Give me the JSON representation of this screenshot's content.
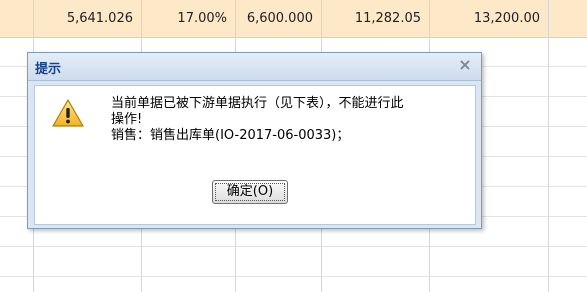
{
  "sheet": {
    "row": [
      "5,641.026",
      "17.00%",
      "6,600.000",
      "11,282.05",
      "13,200.00"
    ]
  },
  "dialog": {
    "title": "提示",
    "close_glyph": "×",
    "icon": "warning-icon",
    "message_line1": "当前单据已被下游单据执行（见下表），不能进行此",
    "message_line2": "操作!",
    "message_line3": "销售：销售出库单(IO-2017-06-0033)；",
    "ok_label": "确定(O)"
  }
}
